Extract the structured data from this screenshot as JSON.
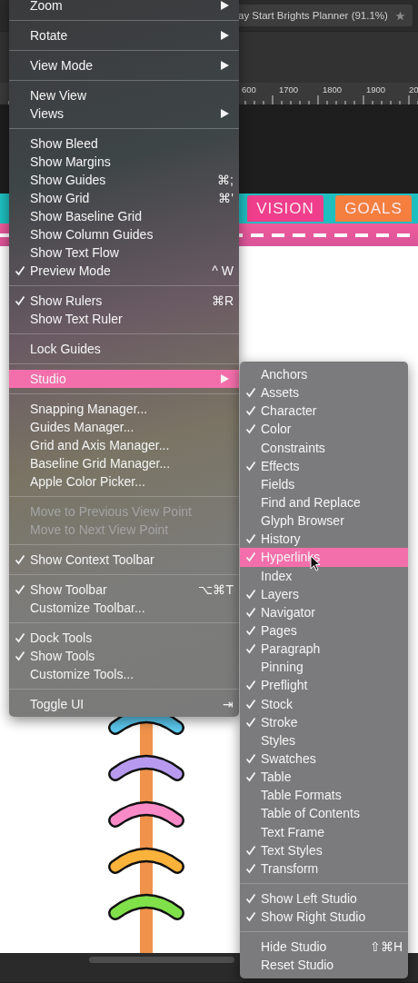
{
  "document_tab": {
    "title": "ay Start Brights Planner (91.1%)"
  },
  "ruler": {
    "labels": [
      "600",
      "1700",
      "1800",
      "1900",
      "20"
    ]
  },
  "planner_tabs": [
    {
      "label": "VISION",
      "color": "#ef3e8b"
    },
    {
      "label": "GOALS",
      "color": "#f47f3f"
    }
  ],
  "menu": {
    "groups": [
      [
        {
          "label": "Zoom",
          "checked": false,
          "submenu": true,
          "selected": false
        }
      ],
      [
        {
          "label": "Rotate",
          "checked": false,
          "submenu": true,
          "selected": false
        }
      ],
      [
        {
          "label": "View Mode",
          "checked": false,
          "submenu": true,
          "selected": false
        }
      ],
      [
        {
          "label": "New View",
          "checked": false,
          "selected": false
        },
        {
          "label": "Views",
          "checked": false,
          "submenu": true,
          "selected": false
        }
      ],
      [
        {
          "label": "Show Bleed",
          "checked": false,
          "selected": false
        },
        {
          "label": "Show Margins",
          "checked": false,
          "selected": false
        },
        {
          "label": "Show Guides",
          "checked": false,
          "shortcut": "⌘;",
          "selected": false
        },
        {
          "label": "Show Grid",
          "checked": false,
          "shortcut": "⌘'",
          "selected": false
        },
        {
          "label": "Show Baseline Grid",
          "checked": false,
          "selected": false
        },
        {
          "label": "Show Column Guides",
          "checked": false,
          "selected": false
        },
        {
          "label": "Show Text Flow",
          "checked": false,
          "selected": false
        },
        {
          "label": "Preview Mode",
          "checked": true,
          "shortcut": "^ W",
          "selected": false
        }
      ],
      [
        {
          "label": "Show Rulers",
          "checked": true,
          "shortcut": "⌘R",
          "selected": false
        },
        {
          "label": "Show Text Ruler",
          "checked": false,
          "selected": false
        }
      ],
      [
        {
          "label": "Lock Guides",
          "checked": false,
          "selected": false
        }
      ],
      [
        {
          "label": "Studio",
          "checked": false,
          "submenu": true,
          "selected": true
        }
      ],
      [
        {
          "label": "Snapping Manager...",
          "checked": false,
          "selected": false
        },
        {
          "label": "Guides Manager...",
          "checked": false,
          "selected": false
        },
        {
          "label": "Grid and Axis Manager...",
          "checked": false,
          "selected": false
        },
        {
          "label": "Baseline Grid Manager...",
          "checked": false,
          "selected": false
        },
        {
          "label": "Apple Color Picker...",
          "checked": false,
          "selected": false
        }
      ],
      [
        {
          "label": "Move to Previous View Point",
          "checked": false,
          "disabled": true,
          "selected": false
        },
        {
          "label": "Move to Next View Point",
          "checked": false,
          "disabled": true,
          "selected": false
        }
      ],
      [
        {
          "label": "Show Context Toolbar",
          "checked": true,
          "selected": false
        }
      ],
      [
        {
          "label": "Show Toolbar",
          "checked": true,
          "shortcut": "⌥⌘T",
          "selected": false
        },
        {
          "label": "Customize Toolbar...",
          "checked": false,
          "selected": false
        }
      ],
      [
        {
          "label": "Dock Tools",
          "checked": true,
          "selected": false
        },
        {
          "label": "Show Tools",
          "checked": true,
          "selected": false
        },
        {
          "label": "Customize Tools...",
          "checked": false,
          "selected": false
        }
      ],
      [
        {
          "label": "Toggle UI",
          "checked": false,
          "shortcut": "⇥",
          "selected": false
        }
      ]
    ]
  },
  "studio_submenu": {
    "groups": [
      [
        {
          "label": "Anchors",
          "checked": false,
          "selected": false
        },
        {
          "label": "Assets",
          "checked": true,
          "selected": false
        },
        {
          "label": "Character",
          "checked": true,
          "selected": false
        },
        {
          "label": "Color",
          "checked": true,
          "selected": false
        },
        {
          "label": "Constraints",
          "checked": false,
          "selected": false
        },
        {
          "label": "Effects",
          "checked": true,
          "selected": false
        },
        {
          "label": "Fields",
          "checked": false,
          "selected": false
        },
        {
          "label": "Find and Replace",
          "checked": false,
          "selected": false
        },
        {
          "label": "Glyph Browser",
          "checked": false,
          "selected": false
        },
        {
          "label": "History",
          "checked": true,
          "selected": false
        },
        {
          "label": "Hyperlinks",
          "checked": true,
          "selected": true
        },
        {
          "label": "Index",
          "checked": false,
          "selected": false
        },
        {
          "label": "Layers",
          "checked": true,
          "selected": false
        },
        {
          "label": "Navigator",
          "checked": true,
          "selected": false
        },
        {
          "label": "Pages",
          "checked": true,
          "selected": false
        },
        {
          "label": "Paragraph",
          "checked": true,
          "selected": false
        },
        {
          "label": "Pinning",
          "checked": false,
          "selected": false
        },
        {
          "label": "Preflight",
          "checked": true,
          "selected": false
        },
        {
          "label": "Stock",
          "checked": true,
          "selected": false
        },
        {
          "label": "Stroke",
          "checked": true,
          "selected": false
        },
        {
          "label": "Styles",
          "checked": false,
          "selected": false
        },
        {
          "label": "Swatches",
          "checked": true,
          "selected": false
        },
        {
          "label": "Table",
          "checked": true,
          "selected": false
        },
        {
          "label": "Table Formats",
          "checked": false,
          "selected": false
        },
        {
          "label": "Table of Contents",
          "checked": false,
          "selected": false
        },
        {
          "label": "Text Frame",
          "checked": false,
          "selected": false
        },
        {
          "label": "Text Styles",
          "checked": true,
          "selected": false
        },
        {
          "label": "Transform",
          "checked": true,
          "selected": false
        }
      ],
      [
        {
          "label": "Show Left Studio",
          "checked": true,
          "selected": false
        },
        {
          "label": "Show Right Studio",
          "checked": true,
          "selected": false
        }
      ],
      [
        {
          "label": "Hide Studio",
          "checked": false,
          "shortcut": "⇧⌘H",
          "selected": false
        },
        {
          "label": "Reset Studio",
          "checked": false,
          "selected": false
        }
      ]
    ]
  }
}
